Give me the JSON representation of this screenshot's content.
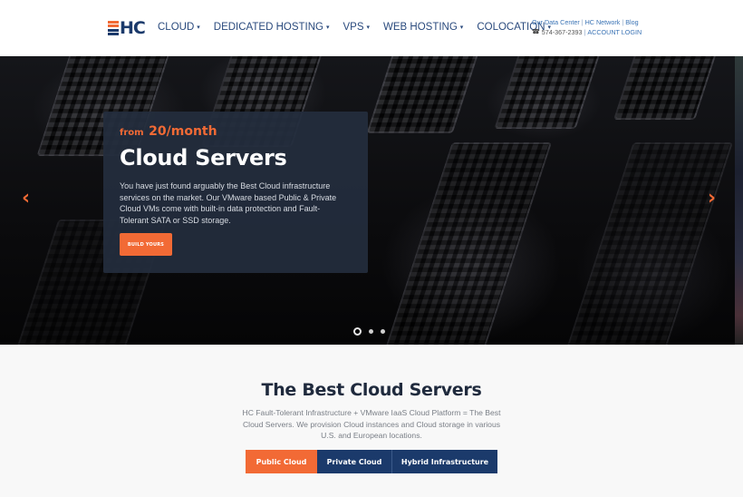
{
  "header": {
    "logo_text": "HC",
    "nav": [
      {
        "label": "CLOUD",
        "has_dropdown": true
      },
      {
        "label": "DEDICATED HOSTING",
        "has_dropdown": true
      },
      {
        "label": "VPS",
        "has_dropdown": true
      },
      {
        "label": "WEB HOSTING",
        "has_dropdown": true
      },
      {
        "label": "COLOCATION",
        "has_dropdown": true
      }
    ],
    "top_links": {
      "data_center": "Our Data Center",
      "hc_network": "HC Network",
      "blog": "Blog",
      "separator": "|",
      "phone": "574-367-2393",
      "account_login": "ACCOUNT LOGIN"
    }
  },
  "hero": {
    "price_prefix": "from",
    "price": "20/month",
    "title": "Cloud Servers",
    "description": "You have just found arguably the Best Cloud infrastructure services on the market. Our VMware based Public & Private Cloud VMs come with built-in data protection and Fault-Tolerant SATA or SSD storage.",
    "cta_label": "BUILD YOURS",
    "prev_arrow": "‹",
    "next_arrow": "›",
    "slides_total": 3,
    "active_slide": 1
  },
  "section": {
    "title": "The Best Cloud Servers",
    "description": "HC Fault-Tolerant Infrastructure + VMware IaaS Cloud Platform = The Best Cloud Servers. We provision Cloud instances and Cloud storage in various U.S. and European locations.",
    "tabs": [
      {
        "label": "Public Cloud",
        "active": true
      },
      {
        "label": "Private Cloud",
        "active": false
      },
      {
        "label": "Hybrid Infrastructure",
        "active": false
      }
    ]
  },
  "colors": {
    "brand_orange": "#f26a35",
    "brand_navy": "#1b3a6b",
    "card_bg": "#242d3d",
    "link_blue": "#3a73b5"
  }
}
